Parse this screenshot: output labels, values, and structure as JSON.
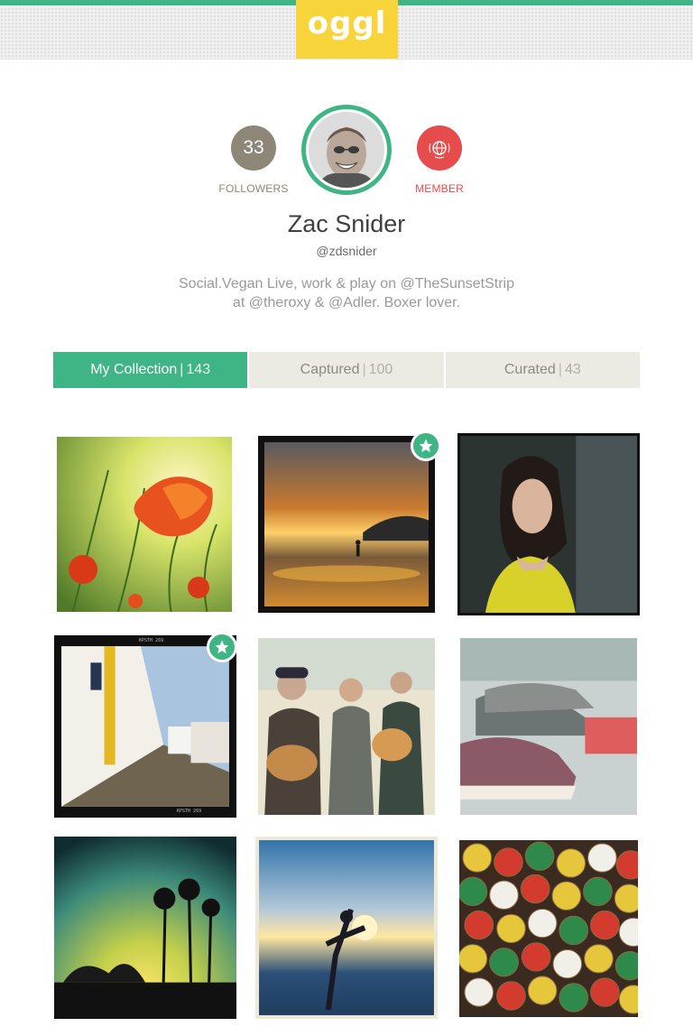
{
  "header": {
    "logo_text": "oggl",
    "accent_color": "#3fb585",
    "logo_bg": "#f7d43a"
  },
  "profile": {
    "followers_count": "33",
    "followers_label": "FOLLOWERS",
    "member_label": "MEMBER",
    "member_icon": "globe-icon",
    "name": "Zac Snider",
    "handle": "@zdsnider",
    "bio_line1": "Social.Vegan Live, work & play on @TheSunsetStrip",
    "bio_line2": "at @theroxy & @Adler. Boxer lover."
  },
  "tabs": [
    {
      "label": "My Collection",
      "count": "143",
      "active": true
    },
    {
      "label": "Captured",
      "count": "100",
      "active": false
    },
    {
      "label": "Curated",
      "count": "43",
      "active": false
    }
  ],
  "photos": [
    {
      "subject": "poppy-flower-photo",
      "starred": false
    },
    {
      "subject": "beach-sunset-photo",
      "starred": true
    },
    {
      "subject": "woman-portrait-photo",
      "starred": false
    },
    {
      "subject": "colonial-street-photo",
      "starred": true
    },
    {
      "subject": "musicians-guitar-photo",
      "starred": false
    },
    {
      "subject": "sneakers-photo",
      "starred": false
    },
    {
      "subject": "palm-sunset-photo",
      "starred": false
    },
    {
      "subject": "beach-jump-photo",
      "starred": false
    },
    {
      "subject": "bottle-caps-photo",
      "starred": false
    }
  ],
  "photo_film_marks": [
    "KPSTH 269",
    "KPSTH 269"
  ]
}
